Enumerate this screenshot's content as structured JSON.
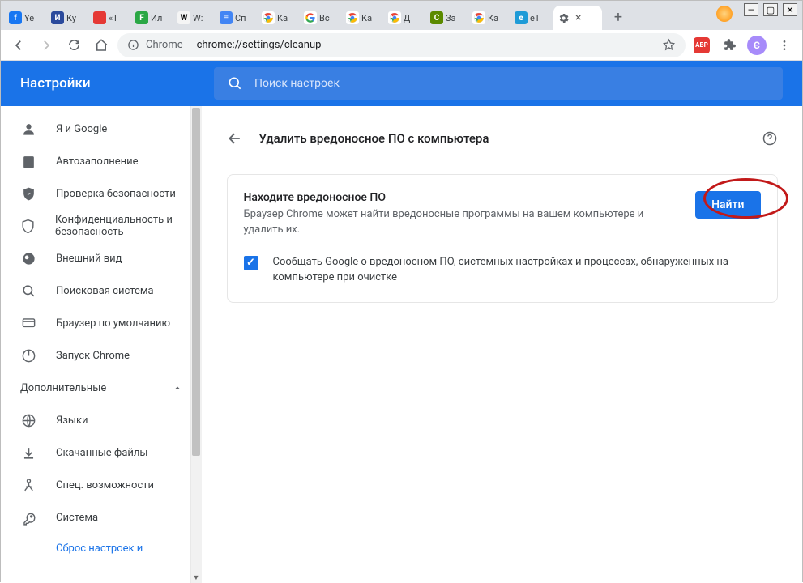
{
  "window": {
    "tabs": [
      {
        "label": "Ye",
        "fav_bg": "#1877f2",
        "fav_text": "f"
      },
      {
        "label": "Ку",
        "fav_bg": "#2b4a9c",
        "fav_text": "И"
      },
      {
        "label": "«Т",
        "fav_bg": "#e53935",
        "fav_text": ""
      },
      {
        "label": "Ил",
        "fav_bg": "#2aa745",
        "fav_text": "F"
      },
      {
        "label": "W:",
        "fav_bg": "#f5f5f5",
        "fav_text": "W",
        "fav_color": "#000"
      },
      {
        "label": "Сп",
        "fav_bg": "#4285f4",
        "fav_text": "≡"
      },
      {
        "label": "Ка",
        "fav_bg": "#fff",
        "fav_text": "",
        "chrome": true
      },
      {
        "label": "Вс",
        "fav_bg": "#fff",
        "fav_text": "G",
        "google": true
      },
      {
        "label": "Ка",
        "fav_bg": "#fff",
        "fav_text": "",
        "chrome": true
      },
      {
        "label": "Д",
        "fav_bg": "#fff",
        "fav_text": "",
        "chrome": true
      },
      {
        "label": "За",
        "fav_bg": "#5b8a00",
        "fav_text": "С"
      },
      {
        "label": "Ка",
        "fav_bg": "#fff",
        "fav_text": "",
        "chrome": true
      },
      {
        "label": "еТ",
        "fav_bg": "#1e9bd7",
        "fav_text": "е"
      }
    ],
    "active_tab": {
      "label": ""
    },
    "avatar_letter": "Є"
  },
  "addressbar": {
    "scheme": "Chrome",
    "url": "chrome://settings/cleanup"
  },
  "header": {
    "title": "Настройки",
    "search_placeholder": "Поиск настроек"
  },
  "sidebar": {
    "items": [
      {
        "label": "Я и Google"
      },
      {
        "label": "Автозаполнение"
      },
      {
        "label": "Проверка безопасности"
      },
      {
        "label": "Конфиденциальность и безопасность"
      },
      {
        "label": "Внешний вид"
      },
      {
        "label": "Поисковая система"
      },
      {
        "label": "Браузер по умолчанию"
      },
      {
        "label": "Запуск Chrome"
      }
    ],
    "group": "Дополнительные",
    "adv": [
      {
        "label": "Языки"
      },
      {
        "label": "Скачанные файлы"
      },
      {
        "label": "Спец. возможности"
      },
      {
        "label": "Система"
      }
    ],
    "reset_link": "Сброс настроек и"
  },
  "main": {
    "page_title": "Удалить вредоносное ПО с компьютера",
    "section_heading": "Находите вредоносное ПО",
    "section_desc": "Браузер Chrome может найти вредоносные программы на вашем компьютере и удалить их.",
    "find_button": "Найти",
    "report_label": "Сообщать Google о вредоносном ПО, системных настройках и процессах, обнаруженных на компьютере при очистке"
  }
}
